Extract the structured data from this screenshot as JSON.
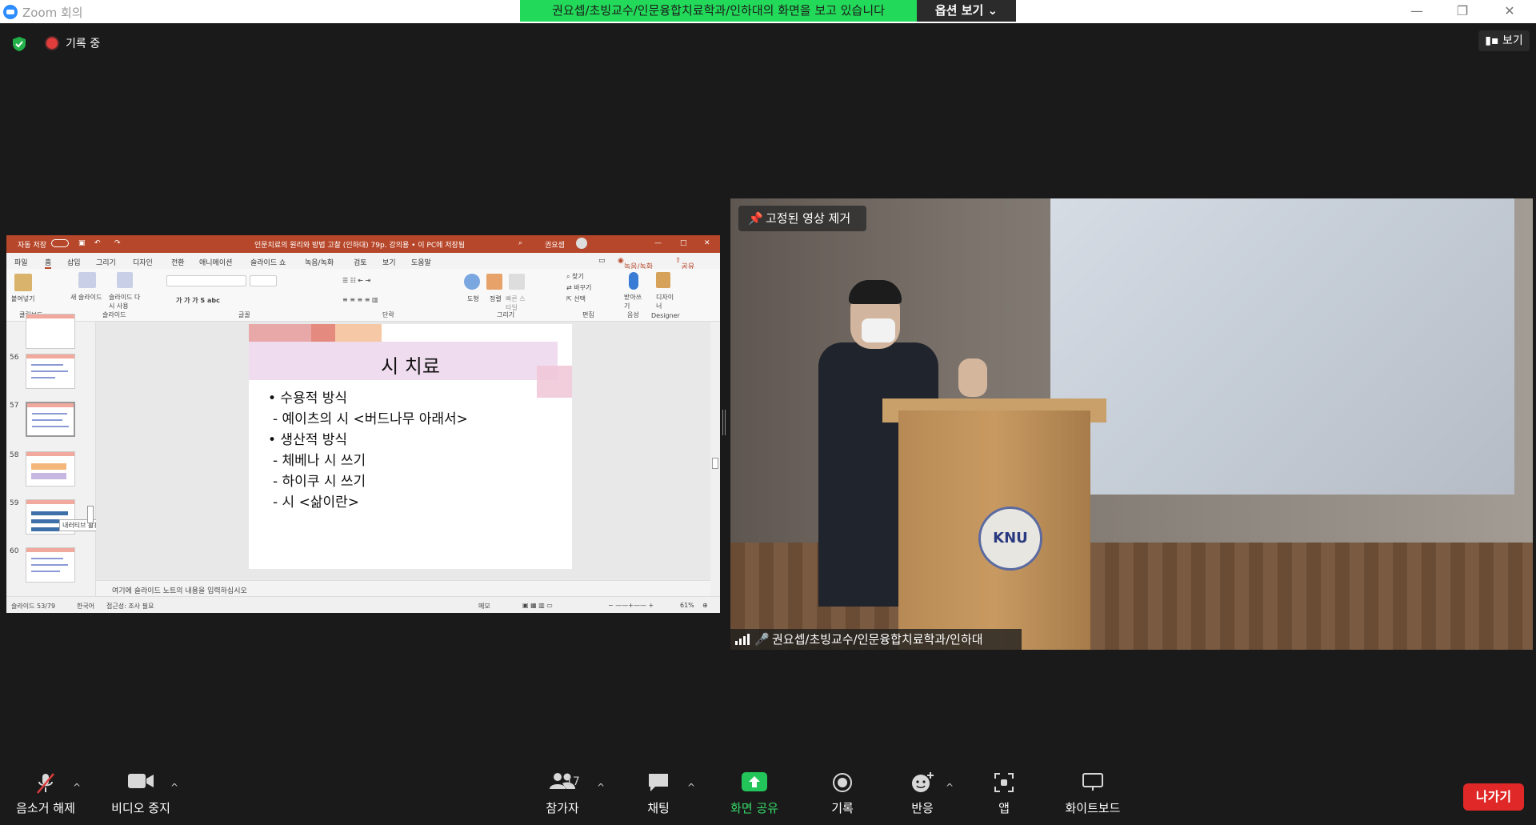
{
  "window": {
    "title": "Zoom 회의"
  },
  "share_banner": {
    "text": "권요셉/초빙교수/인문융합치료학과/인하대의 화면을 보고 있습니다",
    "options_label": "옵션 보기"
  },
  "window_controls": {
    "minimize": "—",
    "restore": "❐",
    "close": "✕"
  },
  "status": {
    "recording_label": "기록 중",
    "view_label": "보기"
  },
  "powerpoint": {
    "autosave_label": "자동 저장",
    "doc_title": "인문치료의 원리와 방법 고찰 (인하대) 79p. 강의용 • 이 PC에 저장됨",
    "user_name": "권요셉",
    "menu": [
      "파일",
      "홈",
      "삽입",
      "그리기",
      "디자인",
      "전환",
      "애니메이션",
      "슬라이드 쇼",
      "녹음/녹화",
      "검토",
      "보기",
      "도움말"
    ],
    "record_label": "녹음/녹화",
    "share_label": "공유",
    "ribbon": {
      "groups": [
        "클립보드",
        "슬라이드",
        "글꼴",
        "단락",
        "그리기",
        "편집",
        "음성",
        "Designer"
      ],
      "paste": "붙여넣기",
      "new_slide": "새 슬라이드",
      "reuse_slide": "슬라이드 다시 사용",
      "shape": "도형",
      "arrange": "정렬",
      "quick_style": "빠른 스타일",
      "find": "찾기",
      "replace": "바꾸기",
      "select": "선택",
      "dictate": "받아쓰기",
      "designer": "디자이너"
    },
    "thumb_numbers": [
      "56",
      "57",
      "58",
      "59",
      "60"
    ],
    "tooltip": "내러티브 활용 인문치료",
    "slide": {
      "title": "시 치료",
      "lines": [
        "• 수용적 방식",
        "- 예이츠의 시 <버드나무 아래서>",
        "• 생산적 방식",
        "- 체베나 시 쓰기",
        "- 하이쿠 시 쓰기",
        "- 시 <삶이란>"
      ]
    },
    "notes_placeholder": "여기에 슬라이드 노트의 내용을 입력하십시오",
    "statusbar": {
      "slide_count": "슬라이드 53/79",
      "language": "한국어",
      "accessibility": "접근성: 조사 필요",
      "notes": "메모",
      "zoom": "61%"
    }
  },
  "video": {
    "pin_remove_label": "고정된 영상 제거",
    "participant_name": "권요셉/초빙교수/인문융합치료학과/인하대",
    "seal_text": "KNU"
  },
  "toolbar": {
    "unmute": "음소거 해제",
    "stop_video": "비디오 중지",
    "participants": "참가자",
    "participant_count": "17",
    "chat": "채팅",
    "share_screen": "화면 공유",
    "record": "기록",
    "reactions": "반응",
    "apps": "앱",
    "whiteboard": "화이트보드",
    "leave": "나가기"
  },
  "colors": {
    "share_green": "#23d959",
    "powerpoint_red": "#b7472a",
    "leave_red": "#e02828"
  }
}
